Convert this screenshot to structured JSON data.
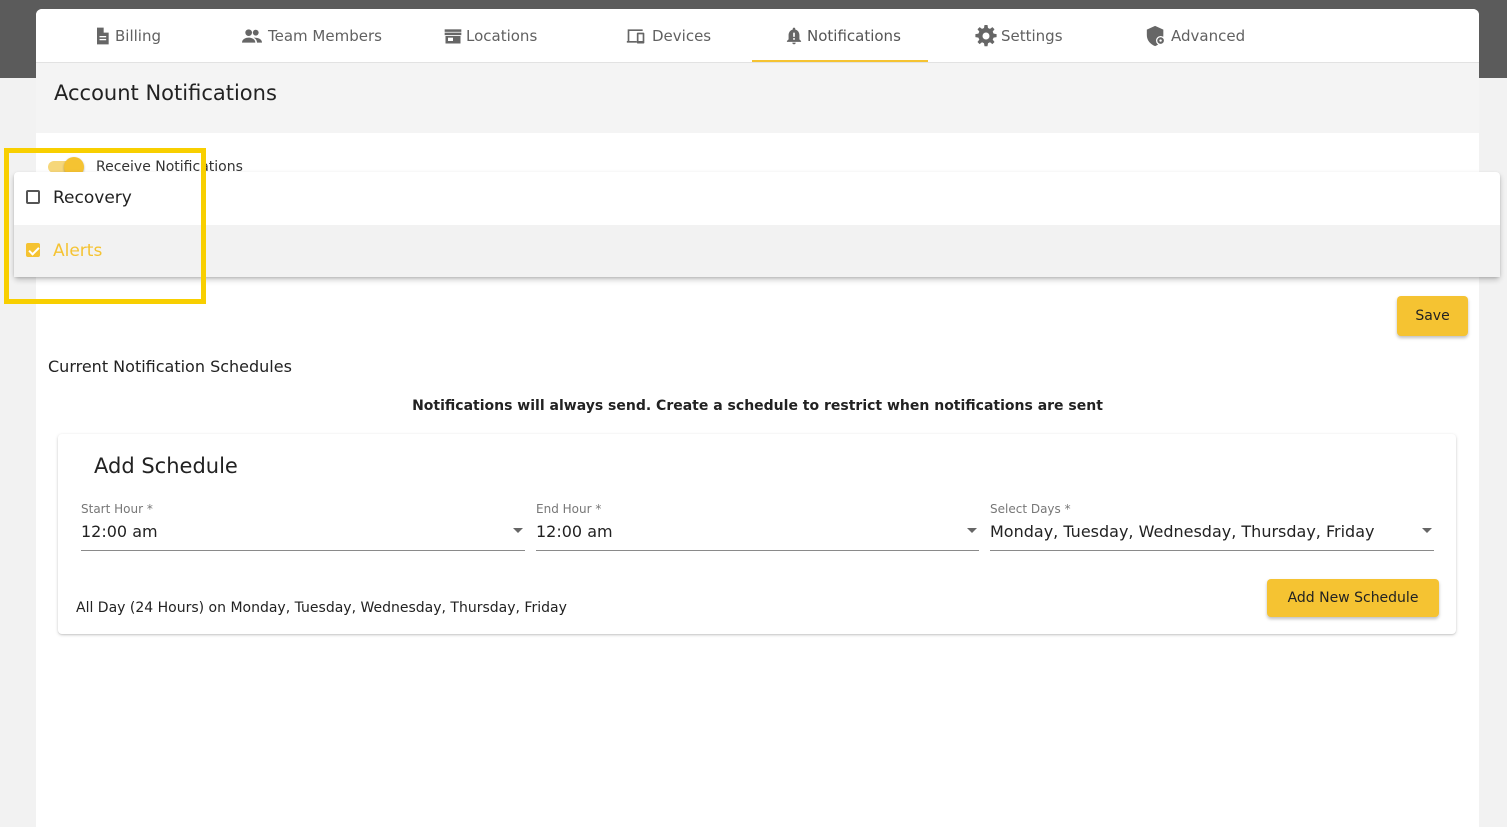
{
  "tabs": [
    {
      "label": "Billing",
      "icon": "document-icon"
    },
    {
      "label": "Team Members",
      "icon": "people-icon"
    },
    {
      "label": "Locations",
      "icon": "store-icon"
    },
    {
      "label": "Devices",
      "icon": "devices-icon"
    },
    {
      "label": "Notifications",
      "icon": "bell-icon",
      "active": true
    },
    {
      "label": "Settings",
      "icon": "gear-icon"
    },
    {
      "label": "Advanced",
      "icon": "shield-icon"
    }
  ],
  "page_title": "Account Notifications",
  "toggle": {
    "label": "Receive Notifications",
    "on": true
  },
  "dropdown": {
    "options": [
      {
        "label": "Recovery",
        "checked": false
      },
      {
        "label": "Alerts",
        "checked": true
      }
    ]
  },
  "save_label": "Save",
  "schedules": {
    "title": "Current Notification Schedules",
    "notice": "Notifications will always send. Create a schedule to restrict when notifications are sent"
  },
  "add_schedule": {
    "title": "Add Schedule",
    "start_hour": {
      "label": "Start Hour *",
      "value": "12:00 am"
    },
    "end_hour": {
      "label": "End Hour *",
      "value": "12:00 am"
    },
    "select_days": {
      "label": "Select Days *",
      "value": "Monday, Tuesday, Wednesday, Thursday, Friday"
    },
    "summary": "All Day (24 Hours) on Monday, Tuesday, Wednesday, Thursday, Friday",
    "button_label": "Add New Schedule"
  },
  "colors": {
    "accent": "#f5c332",
    "highlight": "#f8cf00"
  }
}
